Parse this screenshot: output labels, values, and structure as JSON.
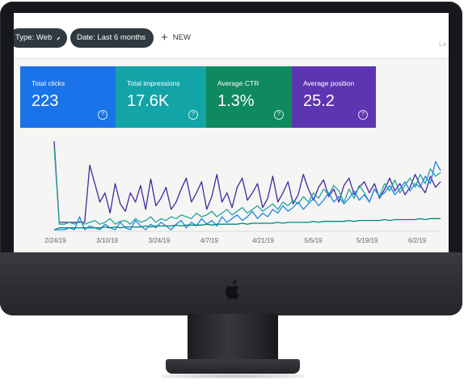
{
  "toolbar": {
    "type_chip": "Type: Web",
    "date_chip": "Date: Last 6 months",
    "new_label": "NEW",
    "edge_text": "La"
  },
  "metrics": [
    {
      "label": "Total clicks",
      "value": "223",
      "color": "#1a73e8"
    },
    {
      "label": "Total impressions",
      "value": "17.6K",
      "color": "#12a4a7"
    },
    {
      "label": "Average CTR",
      "value": "1.3%",
      "color": "#0f8a5f"
    },
    {
      "label": "Average position",
      "value": "25.2",
      "color": "#5e35b1"
    }
  ],
  "chart_data": {
    "type": "line",
    "x_tick_labels": [
      "2/24/19",
      "3/10/19",
      "3/24/19",
      "4/7/19",
      "4/21/19",
      "5/5/19",
      "5/19/19",
      "6/2/19"
    ],
    "y_range": [
      0,
      100
    ],
    "grid": false,
    "series": [
      {
        "color": "#4527a0",
        "values": [
          96,
          8,
          8,
          8,
          8,
          8,
          8,
          70,
          50,
          30,
          40,
          18,
          50,
          28,
          20,
          40,
          30,
          48,
          22,
          55,
          26,
          34,
          46,
          22,
          30,
          44,
          56,
          30,
          40,
          52,
          22,
          36,
          60,
          30,
          40,
          24,
          46,
          56,
          32,
          40,
          50,
          24,
          34,
          58,
          30,
          40,
          52,
          28,
          38,
          60,
          44,
          32,
          46,
          54,
          36,
          44,
          30,
          48,
          56,
          38,
          46,
          52,
          40,
          50,
          34,
          44,
          56,
          42,
          50,
          38,
          46,
          60,
          48,
          40,
          58,
          46,
          52
        ]
      },
      {
        "color": "#26a69a",
        "values": [
          90,
          6,
          6,
          8,
          6,
          9,
          6,
          8,
          10,
          6,
          8,
          12,
          6,
          9,
          10,
          6,
          12,
          8,
          10,
          14,
          8,
          12,
          10,
          14,
          12,
          16,
          14,
          12,
          18,
          14,
          16,
          20,
          14,
          18,
          22,
          16,
          20,
          24,
          18,
          22,
          26,
          20,
          24,
          28,
          22,
          30,
          26,
          32,
          28,
          36,
          30,
          40,
          34,
          44,
          38,
          48,
          42,
          30,
          44,
          34,
          48,
          40,
          30,
          44,
          36,
          50,
          42,
          54,
          40,
          48,
          56,
          46,
          60,
          50,
          66,
          58,
          62
        ]
      },
      {
        "color": "#1e88e5",
        "values": [
          0,
          0,
          0,
          2,
          0,
          14,
          0,
          4,
          2,
          0,
          6,
          2,
          0,
          8,
          2,
          0,
          10,
          4,
          0,
          6,
          2,
          8,
          4,
          0,
          6,
          10,
          2,
          8,
          4,
          12,
          6,
          10,
          4,
          14,
          8,
          12,
          16,
          10,
          14,
          20,
          12,
          18,
          14,
          22,
          18,
          26,
          20,
          24,
          30,
          22,
          28,
          34,
          26,
          32,
          40,
          30,
          36,
          28,
          34,
          42,
          32,
          38,
          30,
          44,
          36,
          40,
          48,
          38,
          44,
          52,
          42,
          50,
          46,
          58,
          50,
          74,
          64
        ]
      },
      {
        "color": "#00897b",
        "values": [
          0,
          2,
          2,
          2,
          2,
          2,
          2,
          2,
          2,
          2,
          3,
          2,
          3,
          2,
          3,
          3,
          3,
          3,
          4,
          3,
          4,
          4,
          4,
          4,
          5,
          4,
          5,
          5,
          5,
          5,
          6,
          5,
          6,
          6,
          6,
          6,
          6,
          7,
          6,
          7,
          7,
          7,
          7,
          7,
          8,
          7,
          8,
          8,
          8,
          8,
          8,
          9,
          8,
          9,
          9,
          9,
          9,
          9,
          10,
          9,
          10,
          10,
          10,
          10,
          10,
          11,
          10,
          11,
          11,
          11,
          11,
          11,
          12,
          11,
          12,
          12,
          12
        ]
      }
    ]
  }
}
